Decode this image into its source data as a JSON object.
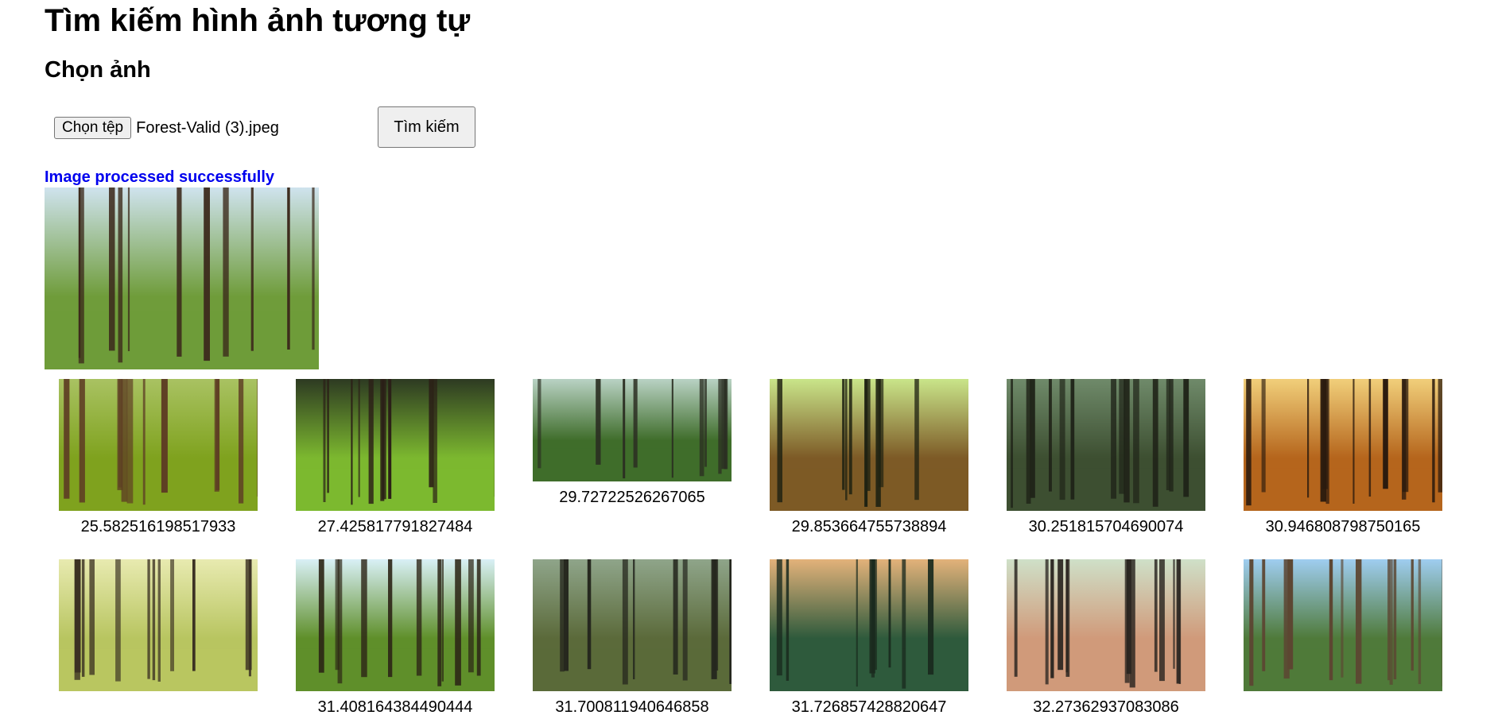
{
  "header": {
    "title": "Tìm kiếm hình ảnh tương tự"
  },
  "upload": {
    "section_title": "Chọn ảnh",
    "file_button_label": "Chọn tệp",
    "file_name": "Forest-Valid (3).jpeg",
    "search_button_label": "Tìm kiếm"
  },
  "status": {
    "message": "Image processed successfully",
    "color": "#0000ee"
  },
  "query_image": {
    "alt": "forest-photo",
    "palette": [
      "#cfe3ee",
      "#6f9c3a",
      "#3c2a1c"
    ]
  },
  "results": [
    {
      "score": "25.582516198517933",
      "palette": [
        "#a9c262",
        "#7fa21e",
        "#5e3d24"
      ]
    },
    {
      "score": "27.425817791827484",
      "palette": [
        "#2d3a22",
        "#7cb82f",
        "#2b1f17"
      ]
    },
    {
      "score": "29.72722526267065",
      "palette": [
        "#b9d2c4",
        "#3f6d2a",
        "#2b2e22"
      ]
    },
    {
      "score": "29.853664755738894",
      "palette": [
        "#c9e58a",
        "#7d5a26",
        "#1f2212"
      ]
    },
    {
      "score": "30.251815704690074",
      "palette": [
        "#6f8a6a",
        "#3d4f31",
        "#1f2318"
      ]
    },
    {
      "score": "30.946808798750165",
      "palette": [
        "#f1cf7a",
        "#b5651c",
        "#2a1a0e"
      ]
    },
    {
      "score": "",
      "palette": [
        "#e8eab0",
        "#b8c560",
        "#3a3022"
      ]
    },
    {
      "score": "31.408164384490444",
      "palette": [
        "#d9f0f6",
        "#5f8f2a",
        "#2c2516"
      ]
    },
    {
      "score": "31.700811940646858",
      "palette": [
        "#8fa58a",
        "#5b6a3a",
        "#25271e"
      ]
    },
    {
      "score": "31.726857428820647",
      "palette": [
        "#e3b27a",
        "#2e5a3c",
        "#1a2a1e"
      ]
    },
    {
      "score": "32.27362937083086",
      "palette": [
        "#cfe0c8",
        "#d09a7a",
        "#2a2520"
      ]
    },
    {
      "score": "",
      "palette": [
        "#9fcdf0",
        "#4f7a3a",
        "#5c4632"
      ]
    }
  ]
}
